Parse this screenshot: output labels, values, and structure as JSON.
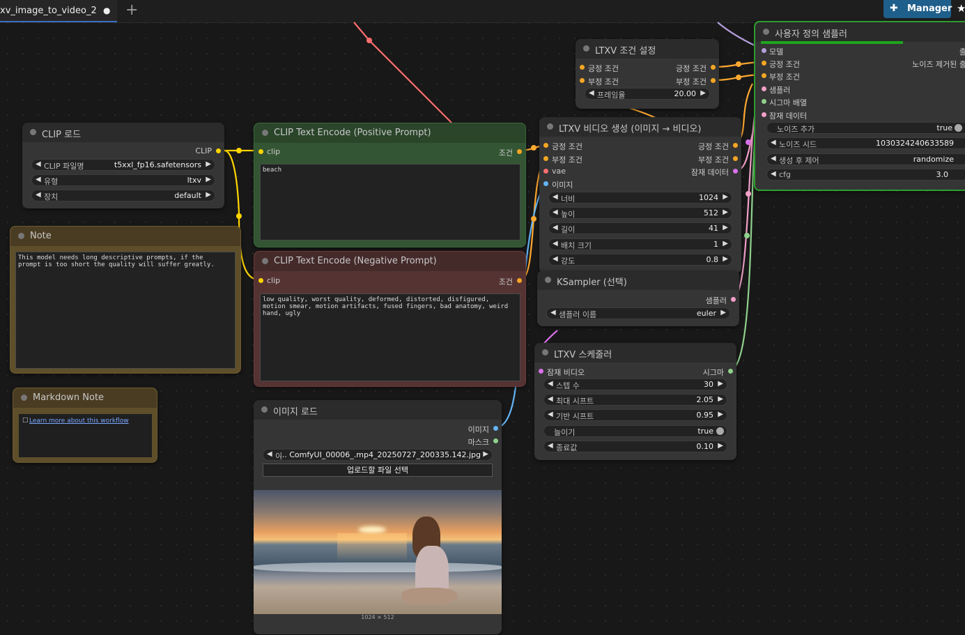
{
  "tab": {
    "label": "xv_image_to_video_2",
    "dot": "●",
    "add": "+"
  },
  "manager": {
    "label": "Manager",
    "icon": "puzzle-icon"
  },
  "nodes": {
    "clip_load": {
      "title": "CLIP 로드",
      "out": "CLIP",
      "w_file": {
        "name": "CLIP 파일명",
        "value": "t5xxl_fp16.safetensors"
      },
      "w_type": {
        "name": "유형",
        "value": "ltxv"
      },
      "w_device": {
        "name": "장치",
        "value": "default"
      }
    },
    "note": {
      "title": "Note",
      "text": "This model needs long descriptive prompts, if the\nprompt is too short the quality will suffer greatly."
    },
    "md_note": {
      "title": "Markdown Note",
      "link": "Learn more about this workflow"
    },
    "pos": {
      "title": "CLIP Text Encode (Positive Prompt)",
      "in": "clip",
      "out": "조건",
      "text": "beach"
    },
    "neg": {
      "title": "CLIP Text Encode (Negative Prompt)",
      "in": "clip",
      "out": "조건",
      "text": "low quality, worst quality, deformed, distorted, disfigured,\nmotion smear, motion artifacts, fused fingers, bad anatomy, weird\nhand, ugly"
    },
    "img_load": {
      "title": "이미지 로드",
      "out_image": "이미지",
      "out_mask": "마스크",
      "w_file": {
        "name": "이",
        "value": "... ComfyUI_00006_.mp4_20250727_200335.142.jpg"
      },
      "upload": "업로드할 파일 선택",
      "size": "1024 × 512"
    },
    "cond": {
      "title": "LTXV 조건 설정",
      "in1": "긍정 조건",
      "in2": "부정 조건",
      "out1": "긍정 조건",
      "out2": "부정 조건",
      "w_fps": {
        "name": "프레임율",
        "value": "20.00"
      }
    },
    "i2v": {
      "title": "LTXV 비디오 생성 (이미지 → 비디오)",
      "in1": "긍정 조건",
      "in2": "부정 조건",
      "in3": "vae",
      "in4": "이미지",
      "out1": "긍정 조건",
      "out2": "부정 조건",
      "out3": "잠재 데이터",
      "w_width": {
        "name": "너비",
        "value": "1024"
      },
      "w_height": {
        "name": "높이",
        "value": "512"
      },
      "w_length": {
        "name": "길이",
        "value": "41"
      },
      "w_batch": {
        "name": "배치 크기",
        "value": "1"
      },
      "w_strength": {
        "name": "강도",
        "value": "0.8"
      }
    },
    "ksampler": {
      "title": "KSampler (선택)",
      "out": "샘플러",
      "w_name": {
        "name": "샘플러 이름",
        "value": "euler"
      }
    },
    "sched": {
      "title": "LTXV 스케줄러",
      "in": "잠재 비디오",
      "out": "시그마",
      "w_steps": {
        "name": "스텝 수",
        "value": "30"
      },
      "w_max": {
        "name": "최대 시프트",
        "value": "2.05"
      },
      "w_base": {
        "name": "기반 시프트",
        "value": "0.95"
      },
      "w_stretch": {
        "name": "늘이기",
        "value": "true"
      },
      "w_term": {
        "name": "종료값",
        "value": "0.10"
      }
    },
    "custom": {
      "title": "사용자 정의 샘플러",
      "in1": "모델",
      "in2": "긍정 조건",
      "in3": "부정 조건",
      "in4": "샘플러",
      "in5": "시그마 배열",
      "in6": "잠재 데이터",
      "out1": "출",
      "out2": "노이즈 제거된 출",
      "w_noise": {
        "name": "노이즈 추가",
        "value": "true"
      },
      "w_seed": {
        "name": "노이즈 시드",
        "value": "1030324240633589"
      },
      "w_ctrl": {
        "name": "생성 후 제어",
        "value": "randomize"
      },
      "w_cfg": {
        "name": "cfg",
        "value": "3.0"
      }
    }
  },
  "colors": {
    "clip": "#ffd500",
    "conditioning": "#ffa931",
    "vae": "#ff6e6e",
    "image": "#64b5f6",
    "latent": "#f2a0c8",
    "model": "#b39ddb",
    "sigmas": "#8fd18c",
    "accent": "#1f5f8b"
  }
}
